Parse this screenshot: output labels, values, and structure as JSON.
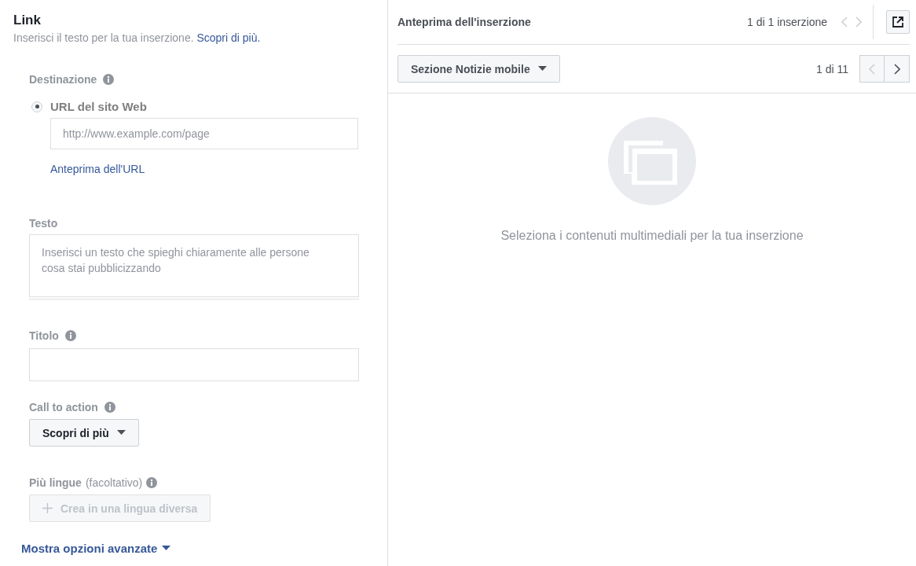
{
  "link": {
    "title": "Link",
    "description": "Inserisci il testo per la tua inserzione.",
    "learn_more": "Scopri di più."
  },
  "destination": {
    "label": "Destinazione",
    "options": [
      {
        "label": "URL del sito Web",
        "selected": true
      }
    ],
    "url_field": {
      "placeholder": "http://www.example.com/page"
    },
    "preview_link": "Anteprima dell'URL"
  },
  "text": {
    "label": "Testo",
    "placeholder": "Inserisci un testo che spieghi chiaramente alle persone cosa stai pubblicizzando"
  },
  "headline": {
    "label": "Titolo"
  },
  "call_to_action": {
    "label": "Call to action",
    "value": "Scopri di più"
  },
  "languages": {
    "label": "Più lingue",
    "note": "(facoltativo)",
    "button": {
      "label": "Crea in una lingua diversa",
      "disabled": true
    }
  },
  "advanced_link": "Mostra opzioni avanzate",
  "preview": {
    "title": "Anteprima dell'inserzione",
    "counter": "1 di 1 inserzione",
    "pager": {
      "prev_disabled": true,
      "next_disabled": true
    },
    "placement": "Sezione Notizie mobile",
    "placement_counter": "1 di 11",
    "placement_pager": {
      "prev_disabled": true,
      "next_disabled": false
    },
    "message": "Seleziona i contenuti multimediali per la tua inserzione"
  }
}
